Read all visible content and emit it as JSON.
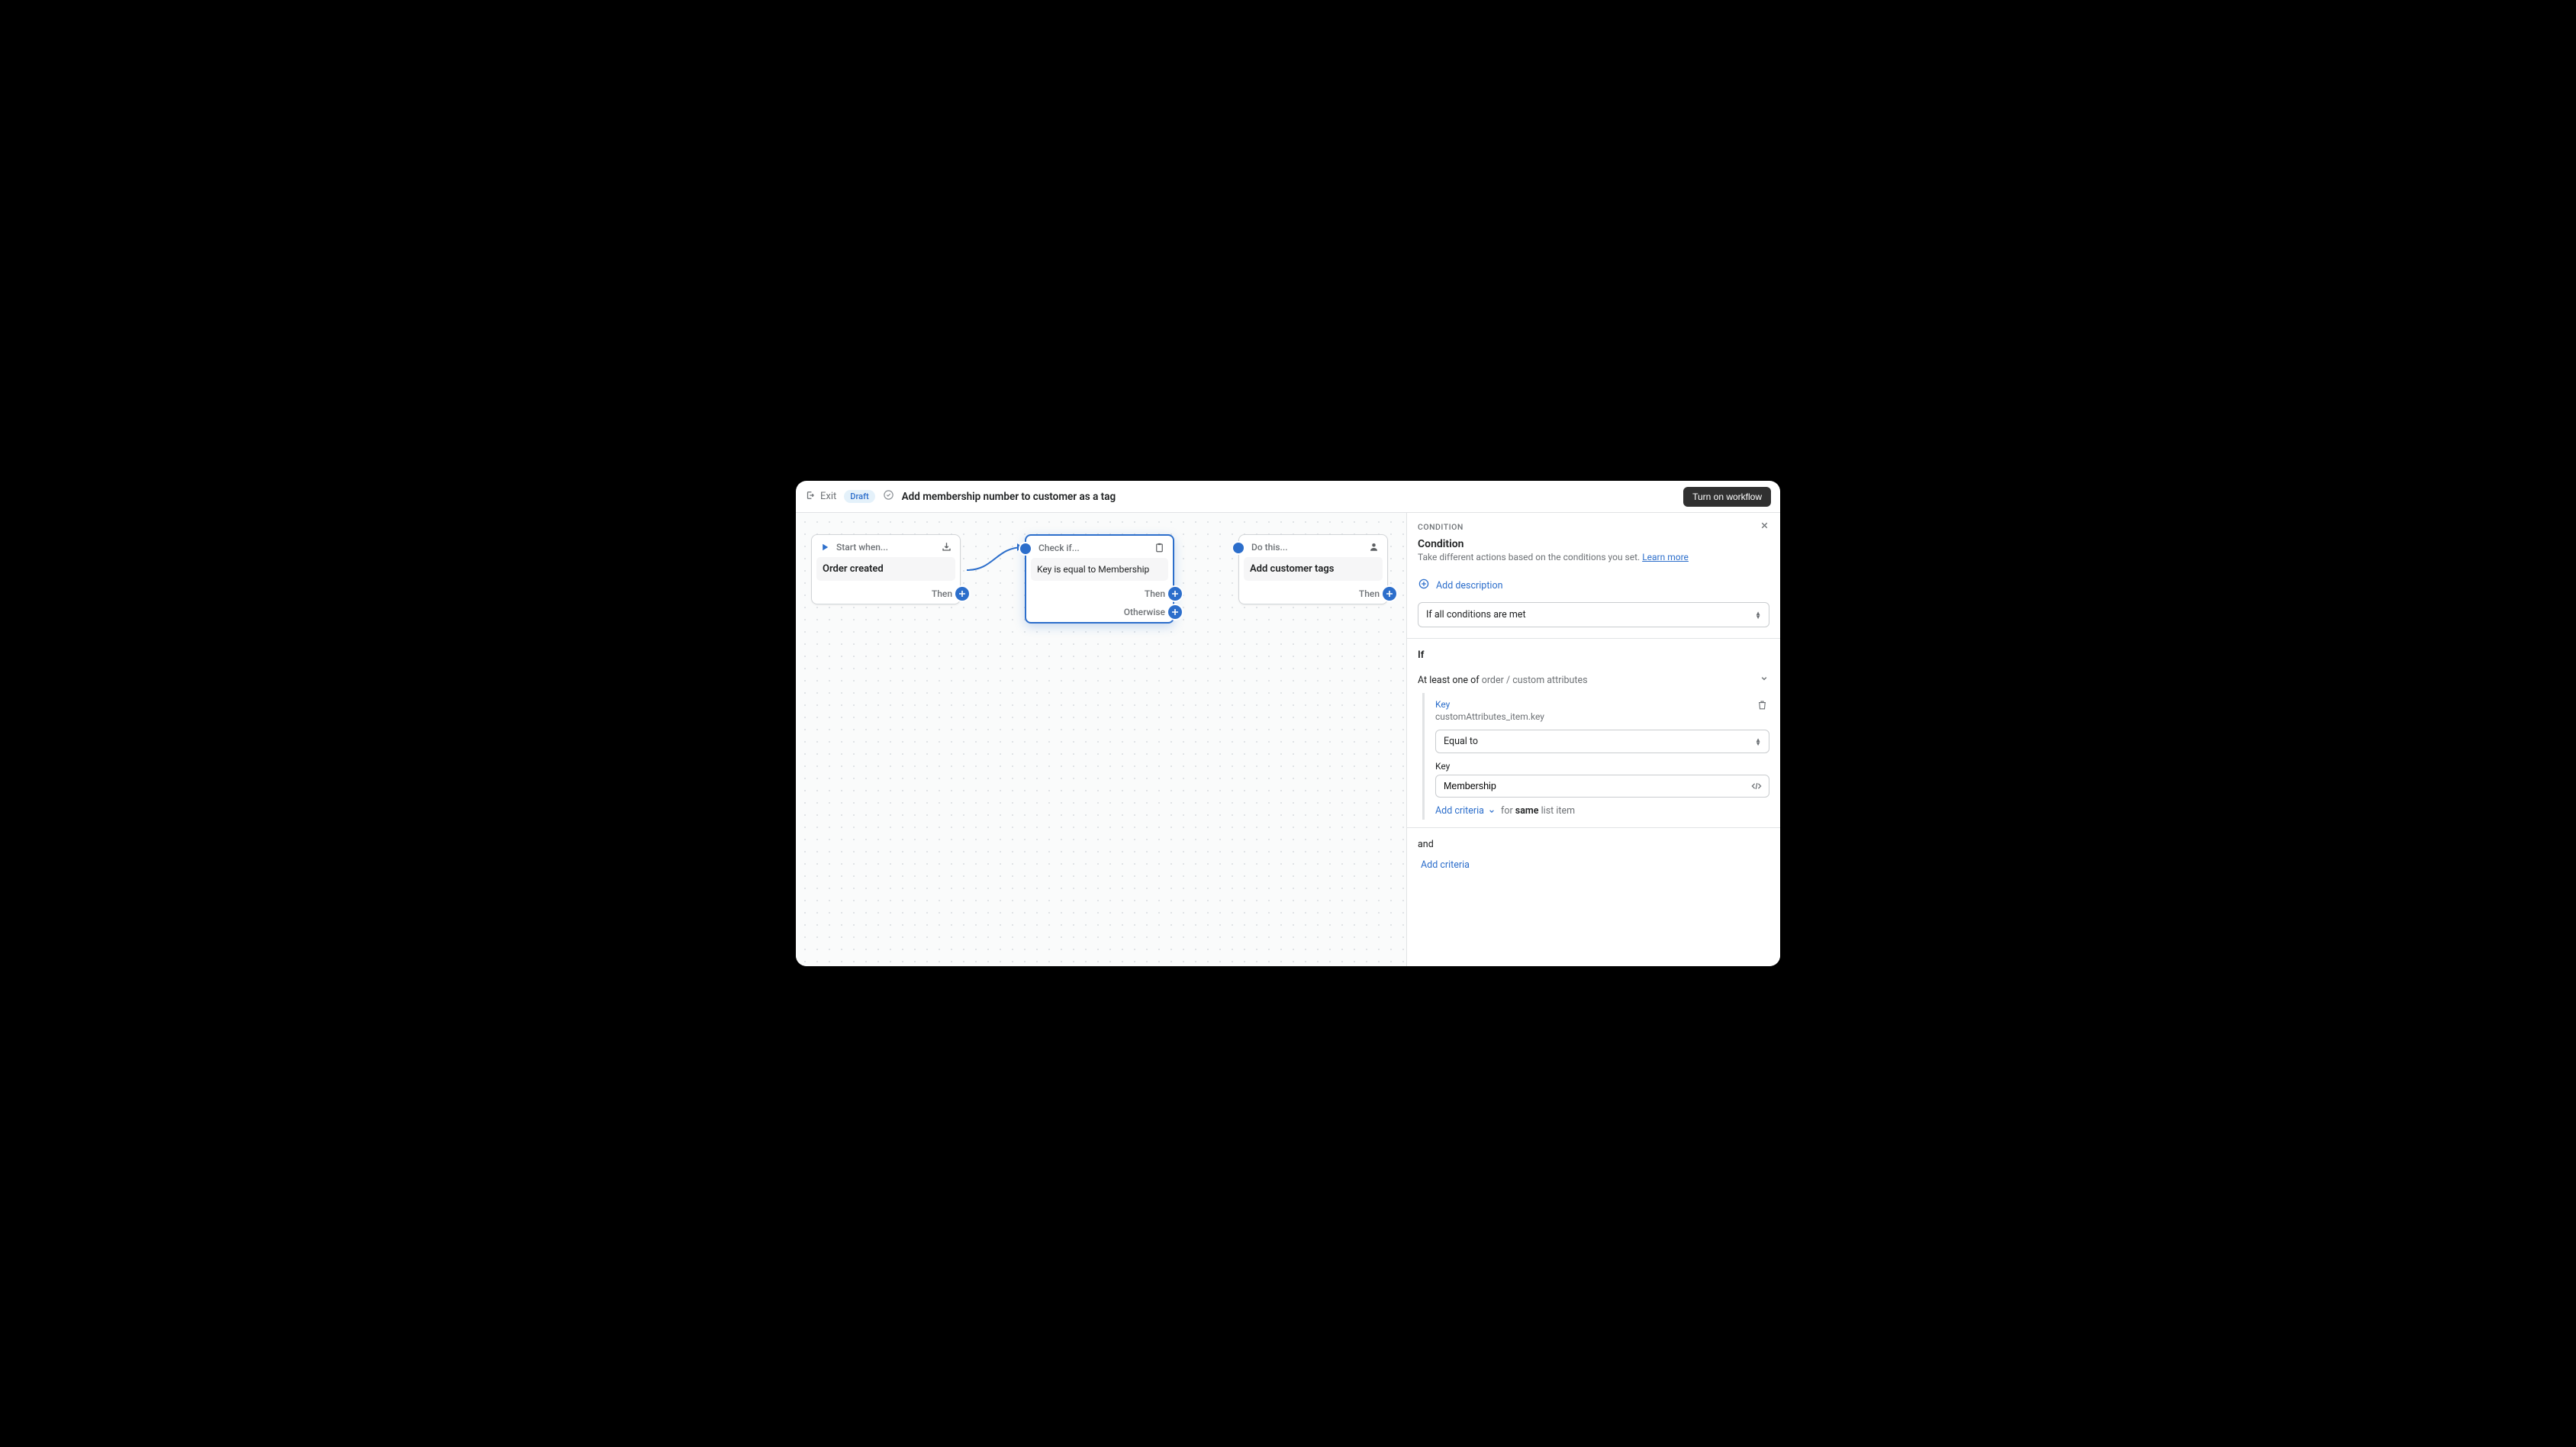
{
  "header": {
    "exit": "Exit",
    "draft_badge": "Draft",
    "title": "Add membership number to customer as a tag",
    "turn_on": "Turn on workflow"
  },
  "nodes": {
    "start": {
      "head": "Start when...",
      "body": "Order created",
      "then": "Then"
    },
    "check": {
      "head": "Check if...",
      "body": "Key is equal to Membership",
      "then": "Then",
      "otherwise": "Otherwise"
    },
    "action": {
      "head": "Do this...",
      "body": "Add customer tags",
      "then": "Then"
    }
  },
  "sidebar": {
    "caption": "CONDITION",
    "title": "Condition",
    "subtitle": "Take different actions based on the conditions you set. ",
    "learn_more": "Learn more",
    "add_description": "Add description",
    "match_mode": "If all conditions are met",
    "if_label": "If",
    "filter_prefix": "At least one of ",
    "filter_target": "order / custom attributes",
    "criteria": {
      "key_label": "Key",
      "key_path": "customAttributes_item.key",
      "operator": "Equal to",
      "value_label": "Key",
      "value": "Membership"
    },
    "add_criteria": "Add criteria",
    "same_item_for": " for ",
    "same_item_bold": "same",
    "same_item_tail": " list item",
    "and_label": "and",
    "bottom_add_criteria": "Add criteria"
  }
}
